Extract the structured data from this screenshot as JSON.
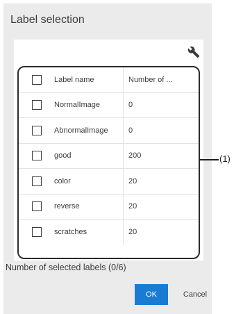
{
  "dialog": {
    "title": "Label selection",
    "settings_icon": "wrench-icon",
    "table": {
      "headers": {
        "name": "Label name",
        "number": "Number of ..."
      },
      "rows": [
        {
          "name": "NormalImage",
          "number": "0"
        },
        {
          "name": "AbnormalImage",
          "number": "0"
        },
        {
          "name": "good",
          "number": "200"
        },
        {
          "name": "color",
          "number": "20"
        },
        {
          "name": "reverse",
          "number": "20"
        },
        {
          "name": "scratches",
          "number": "20"
        }
      ]
    },
    "status": "Number of selected labels (0/6)",
    "ok_label": "OK",
    "cancel_label": "Cancel"
  },
  "callout": "(1)",
  "colors": {
    "accent": "#1a7bd3",
    "dialog_bg": "#ebebeb"
  }
}
